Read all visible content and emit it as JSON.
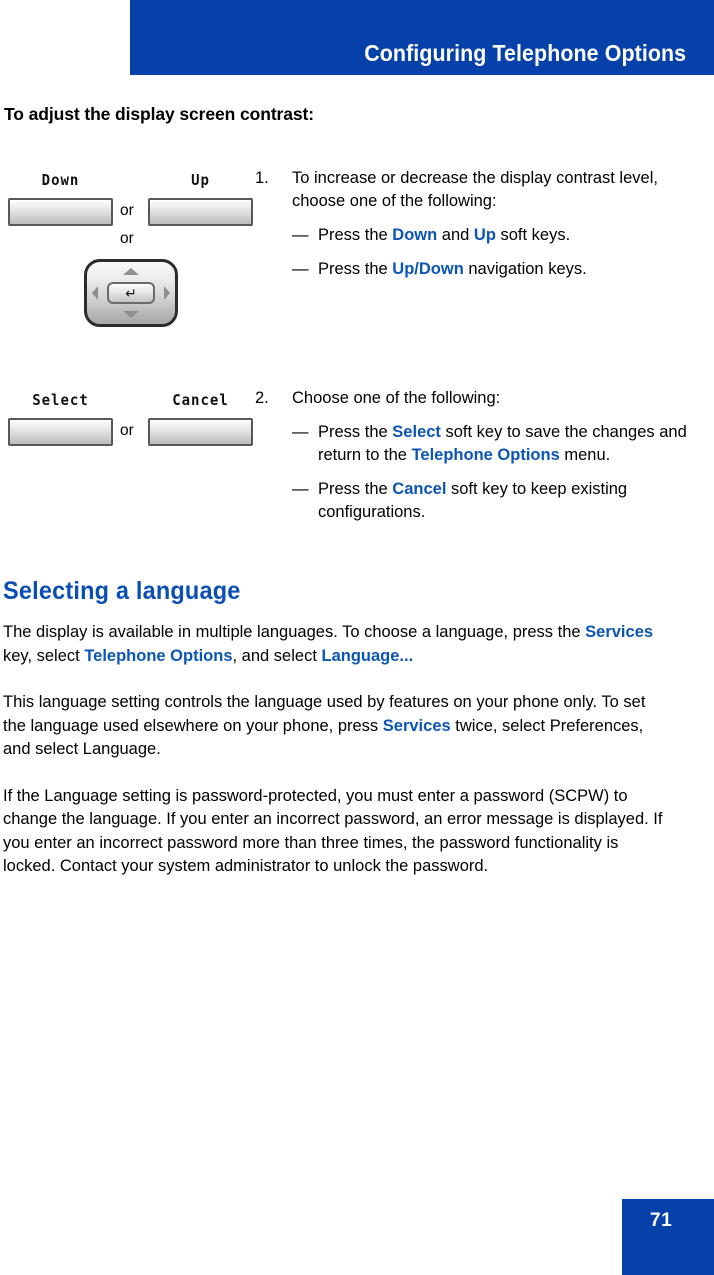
{
  "colors": {
    "banner_blue": "#0541A8",
    "link_blue": "#0B55B5",
    "heading_blue": "#0B4FB5",
    "page_white": "#FFFFFF"
  },
  "header": {
    "title": "Configuring Telephone Options"
  },
  "intro": {
    "heading": "To adjust the display screen contrast:"
  },
  "steps": [
    {
      "number": "1.",
      "main": "To increase or decrease the display contrast level, choose one of the following:",
      "bullets": [
        {
          "dash": "—",
          "parts": [
            {
              "text": "Press the ",
              "style": "plain"
            },
            {
              "text": "Down",
              "style": "key"
            },
            {
              "text": " and ",
              "style": "plain"
            },
            {
              "text": "Up",
              "style": "key"
            },
            {
              "text": " soft keys.",
              "style": "plain"
            }
          ]
        },
        {
          "dash": "—",
          "parts": [
            {
              "text": "Press the ",
              "style": "plain"
            },
            {
              "text": "Up/Down",
              "style": "key"
            },
            {
              "text": " navigation keys.",
              "style": "plain"
            }
          ]
        }
      ],
      "art": {
        "type": "softkeys-and-navpad",
        "softkeys": [
          {
            "label": "Down"
          },
          {
            "label": "Up"
          }
        ],
        "or_labels": [
          "or",
          "or"
        ],
        "navpad": {
          "center_glyph": "↵",
          "arrows": [
            "up",
            "down",
            "left",
            "right"
          ]
        }
      }
    },
    {
      "number": "2.",
      "main": "Choose one of the following:",
      "bullets": [
        {
          "dash": "—",
          "parts": [
            {
              "text": "Press the ",
              "style": "plain"
            },
            {
              "text": "Select",
              "style": "key"
            },
            {
              "text": " soft key to save the changes and return to the ",
              "style": "plain"
            },
            {
              "text": "Telephone Options",
              "style": "key"
            },
            {
              "text": " menu.",
              "style": "plain"
            }
          ]
        },
        {
          "dash": "—",
          "parts": [
            {
              "text": "Press the ",
              "style": "plain"
            },
            {
              "text": "Cancel",
              "style": "key"
            },
            {
              "text": " soft key to keep existing configurations.",
              "style": "plain"
            }
          ]
        }
      ],
      "art": {
        "type": "softkeys",
        "softkeys": [
          {
            "label": "Select"
          },
          {
            "label": "Cancel"
          }
        ],
        "or_labels": [
          "or"
        ]
      }
    }
  ],
  "section": {
    "heading": "Selecting a language",
    "paragraphs": [
      {
        "id": "para-choose-language",
        "parts": [
          {
            "text": "The display is available in multiple languages. To choose a language, press the ",
            "style": "plain"
          },
          {
            "text": "Services",
            "style": "key"
          },
          {
            "text": " key, select ",
            "style": "plain"
          },
          {
            "text": "Telephone Options",
            "style": "key"
          },
          {
            "text": ", and select ",
            "style": "plain"
          },
          {
            "text": "Language...",
            "style": "key"
          }
        ]
      },
      {
        "id": "para-language-scope",
        "parts": [
          {
            "text": "This language setting controls the language used by features on your phone only. To set the language used elsewhere on your phone, press ",
            "style": "plain"
          },
          {
            "text": "Services",
            "style": "key"
          },
          {
            "text": " twice, select Preferences, and select Language.",
            "style": "plain"
          }
        ]
      },
      {
        "id": "para-password-protection",
        "parts": [
          {
            "text": "If the Language setting is password-protected, you must enter a password (SCPW) to change the language. If you enter an incorrect password, an error message is displayed. If you enter an incorrect password more than three times, the password functionality is locked. Contact your system administrator to unlock the password.",
            "style": "plain"
          }
        ]
      }
    ]
  },
  "footer": {
    "page_number": "71"
  }
}
